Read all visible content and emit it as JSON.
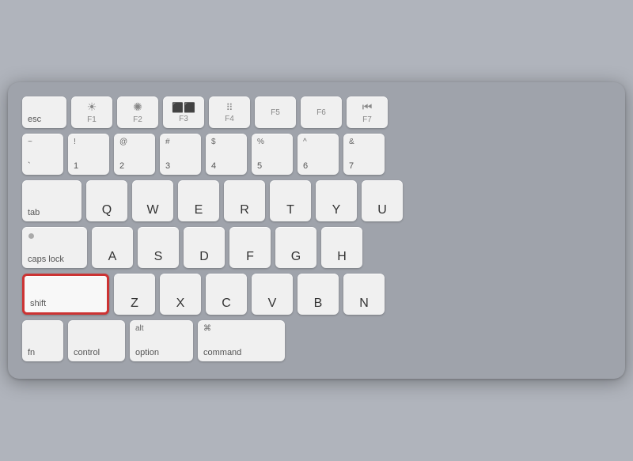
{
  "keyboard": {
    "rows": [
      {
        "id": "fn-row",
        "keys": [
          {
            "id": "esc",
            "label": "esc",
            "width": "w-esc",
            "type": "label-bottom"
          },
          {
            "id": "f1",
            "label": "F1",
            "sublabel": "☀",
            "width": "w-fn-key",
            "type": "fn"
          },
          {
            "id": "f2",
            "label": "F2",
            "sublabel": "☀",
            "width": "w-fn-key",
            "type": "fn"
          },
          {
            "id": "f3",
            "label": "F3",
            "sublabel": "⊞",
            "width": "w-fn-key",
            "type": "fn"
          },
          {
            "id": "f4",
            "label": "F4",
            "sublabel": "⠿",
            "width": "w-fn-key",
            "type": "fn"
          },
          {
            "id": "f5",
            "label": "F5",
            "sublabel": "",
            "width": "w-fn-key",
            "type": "fn"
          },
          {
            "id": "f6",
            "label": "F6",
            "sublabel": "",
            "width": "w-fn-key",
            "type": "fn"
          },
          {
            "id": "f7",
            "label": "F7",
            "sublabel": "⏮",
            "width": "w-fn-key",
            "type": "fn"
          }
        ]
      },
      {
        "id": "number-row",
        "keys": [
          {
            "id": "tilde",
            "top": "~",
            "bottom": "`",
            "width": "w-1u"
          },
          {
            "id": "1",
            "top": "!",
            "bottom": "1",
            "width": "w-1u"
          },
          {
            "id": "2",
            "top": "@",
            "bottom": "2",
            "width": "w-1u"
          },
          {
            "id": "3",
            "top": "#",
            "bottom": "3",
            "width": "w-1u"
          },
          {
            "id": "4",
            "top": "$",
            "bottom": "4",
            "width": "w-1u"
          },
          {
            "id": "5",
            "top": "%",
            "bottom": "5",
            "width": "w-1u"
          },
          {
            "id": "6",
            "top": "^",
            "bottom": "6",
            "width": "w-1u"
          },
          {
            "id": "7",
            "top": "&",
            "bottom": "7",
            "width": "w-1u"
          }
        ]
      },
      {
        "id": "qwerty-row",
        "keys": [
          {
            "id": "tab",
            "label": "tab",
            "width": "w-tab"
          },
          {
            "id": "q",
            "letter": "Q",
            "width": "w-1u"
          },
          {
            "id": "w",
            "letter": "W",
            "width": "w-1u"
          },
          {
            "id": "e",
            "letter": "E",
            "width": "w-1u"
          },
          {
            "id": "r",
            "letter": "R",
            "width": "w-1u"
          },
          {
            "id": "t",
            "letter": "T",
            "width": "w-1u"
          },
          {
            "id": "y",
            "letter": "Y",
            "width": "w-1u"
          },
          {
            "id": "u",
            "letter": "U",
            "width": "w-1u"
          }
        ]
      },
      {
        "id": "asdf-row",
        "keys": [
          {
            "id": "caps",
            "label": "caps lock",
            "dot": true,
            "width": "w-caps"
          },
          {
            "id": "a",
            "letter": "A",
            "width": "w-1u"
          },
          {
            "id": "s",
            "letter": "S",
            "width": "w-1u"
          },
          {
            "id": "d",
            "letter": "D",
            "width": "w-1u"
          },
          {
            "id": "f",
            "letter": "F",
            "width": "w-1u"
          },
          {
            "id": "g",
            "letter": "G",
            "width": "w-1u"
          },
          {
            "id": "h",
            "letter": "H",
            "width": "w-1u"
          }
        ]
      },
      {
        "id": "zxcv-row",
        "keys": [
          {
            "id": "shift-l",
            "label": "shift",
            "width": "w-shift-l",
            "highlight": true
          },
          {
            "id": "z",
            "letter": "Z",
            "width": "w-1u"
          },
          {
            "id": "x",
            "letter": "X",
            "width": "w-1u"
          },
          {
            "id": "c",
            "letter": "C",
            "width": "w-1u"
          },
          {
            "id": "v",
            "letter": "V",
            "width": "w-1u"
          },
          {
            "id": "b",
            "letter": "B",
            "width": "w-1u"
          },
          {
            "id": "n",
            "letter": "N",
            "width": "w-1u"
          }
        ]
      },
      {
        "id": "bottom-row",
        "keys": [
          {
            "id": "fn",
            "label": "fn",
            "width": "w-fn"
          },
          {
            "id": "control",
            "label": "control",
            "width": "w-ctrl"
          },
          {
            "id": "option",
            "top": "alt",
            "bottom": "option",
            "width": "w-option"
          },
          {
            "id": "command",
            "top": "⌘",
            "bottom": "command",
            "width": "w-command"
          }
        ]
      }
    ]
  }
}
